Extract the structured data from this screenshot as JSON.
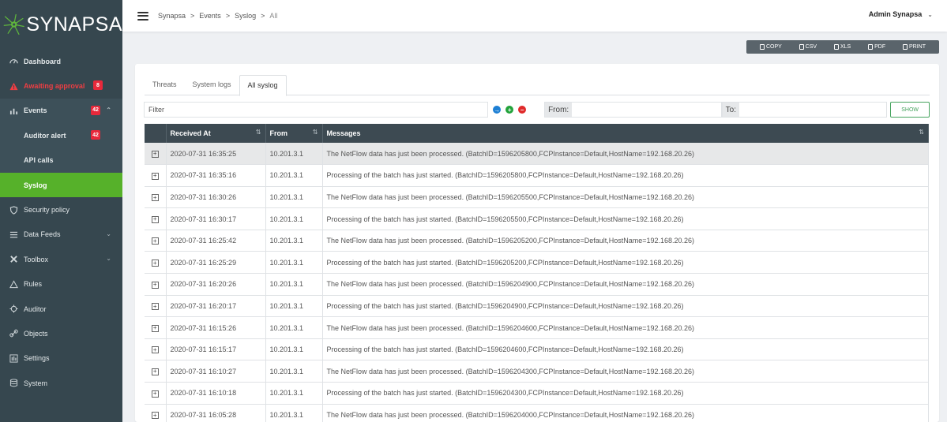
{
  "app": {
    "brand": "SYNAPSA"
  },
  "topbar": {
    "breadcrumb": [
      "Synapsa",
      "Events",
      "Syslog",
      "All"
    ],
    "separator": ">",
    "user": "Admin Synapsa",
    "user_caret": "⌄"
  },
  "sidebar": {
    "items": [
      {
        "label": "Dashboard",
        "icon": "speedometer-icon"
      },
      {
        "label": "Awaiting approval",
        "icon": "warning-icon",
        "badge": "8"
      },
      {
        "label": "Events",
        "icon": "bar-chart-icon",
        "badge": "42",
        "chevron": "⌃"
      },
      {
        "label": "Auditor alert",
        "badge": "42"
      },
      {
        "label": "API calls"
      },
      {
        "label": "Syslog"
      },
      {
        "label": "Security policy",
        "icon": "shield-icon"
      },
      {
        "label": "Data Feeds",
        "icon": "list-icon",
        "chevron": "⌄"
      },
      {
        "label": "Toolbox",
        "icon": "tools-icon",
        "chevron": "⌄"
      },
      {
        "label": "Rules",
        "icon": "alert-triangle-icon"
      },
      {
        "label": "Auditor",
        "icon": "crosshair-icon"
      },
      {
        "label": "Objects",
        "icon": "link-icon"
      },
      {
        "label": "Settings",
        "icon": "settings-icon"
      },
      {
        "label": "System",
        "icon": "database-icon"
      }
    ]
  },
  "export": {
    "buttons": [
      "COPY",
      "CSV",
      "XLS",
      "PDF",
      "PRINT"
    ]
  },
  "tabs": [
    {
      "label": "Threats",
      "active": false
    },
    {
      "label": "System logs",
      "active": false
    },
    {
      "label": "All syslog",
      "active": true
    }
  ],
  "filter": {
    "placeholder": "Filter",
    "from_label": "From:",
    "to_label": "To:",
    "show_label": "SHOW",
    "icons": {
      "go": "→",
      "add": "+",
      "remove": "−"
    }
  },
  "table": {
    "columns": [
      "Received At",
      "From",
      "Messages"
    ],
    "sort_glyph": "⇅",
    "expand_glyph": "+",
    "rows": [
      {
        "received": "2020-07-31 16:35:25",
        "from": "10.201.3.1",
        "message": "The NetFlow data has just been processed. (BatchID=1596205800,FCPInstance=Default,HostName=192.168.20.26)"
      },
      {
        "received": "2020-07-31 16:35:16",
        "from": "10.201.3.1",
        "message": "Processing of the batch has just started. (BatchID=1596205800,FCPInstance=Default,HostName=192.168.20.26)"
      },
      {
        "received": "2020-07-31 16:30:26",
        "from": "10.201.3.1",
        "message": "The NetFlow data has just been processed. (BatchID=1596205500,FCPInstance=Default,HostName=192.168.20.26)"
      },
      {
        "received": "2020-07-31 16:30:17",
        "from": "10.201.3.1",
        "message": "Processing of the batch has just started. (BatchID=1596205500,FCPInstance=Default,HostName=192.168.20.26)"
      },
      {
        "received": "2020-07-31 16:25:42",
        "from": "10.201.3.1",
        "message": "The NetFlow data has just been processed. (BatchID=1596205200,FCPInstance=Default,HostName=192.168.20.26)"
      },
      {
        "received": "2020-07-31 16:25:29",
        "from": "10.201.3.1",
        "message": "Processing of the batch has just started. (BatchID=1596205200,FCPInstance=Default,HostName=192.168.20.26)"
      },
      {
        "received": "2020-07-31 16:20:26",
        "from": "10.201.3.1",
        "message": "The NetFlow data has just been processed. (BatchID=1596204900,FCPInstance=Default,HostName=192.168.20.26)"
      },
      {
        "received": "2020-07-31 16:20:17",
        "from": "10.201.3.1",
        "message": "Processing of the batch has just started. (BatchID=1596204900,FCPInstance=Default,HostName=192.168.20.26)"
      },
      {
        "received": "2020-07-31 16:15:26",
        "from": "10.201.3.1",
        "message": "The NetFlow data has just been processed. (BatchID=1596204600,FCPInstance=Default,HostName=192.168.20.26)"
      },
      {
        "received": "2020-07-31 16:15:17",
        "from": "10.201.3.1",
        "message": "Processing of the batch has just started. (BatchID=1596204600,FCPInstance=Default,HostName=192.168.20.26)"
      },
      {
        "received": "2020-07-31 16:10:27",
        "from": "10.201.3.1",
        "message": "The NetFlow data has just been processed. (BatchID=1596204300,FCPInstance=Default,HostName=192.168.20.26)"
      },
      {
        "received": "2020-07-31 16:10:18",
        "from": "10.201.3.1",
        "message": "Processing of the batch has just started. (BatchID=1596204300,FCPInstance=Default,HostName=192.168.20.26)"
      },
      {
        "received": "2020-07-31 16:05:28",
        "from": "10.201.3.1",
        "message": "The NetFlow data has just been processed. (BatchID=1596204000,FCPInstance=Default,HostName=192.168.20.26)"
      }
    ]
  },
  "colors": {
    "sidebar": "#36474f",
    "accent_green": "#56b12a",
    "danger": "#e8293b",
    "table_header": "#3d4a52"
  }
}
